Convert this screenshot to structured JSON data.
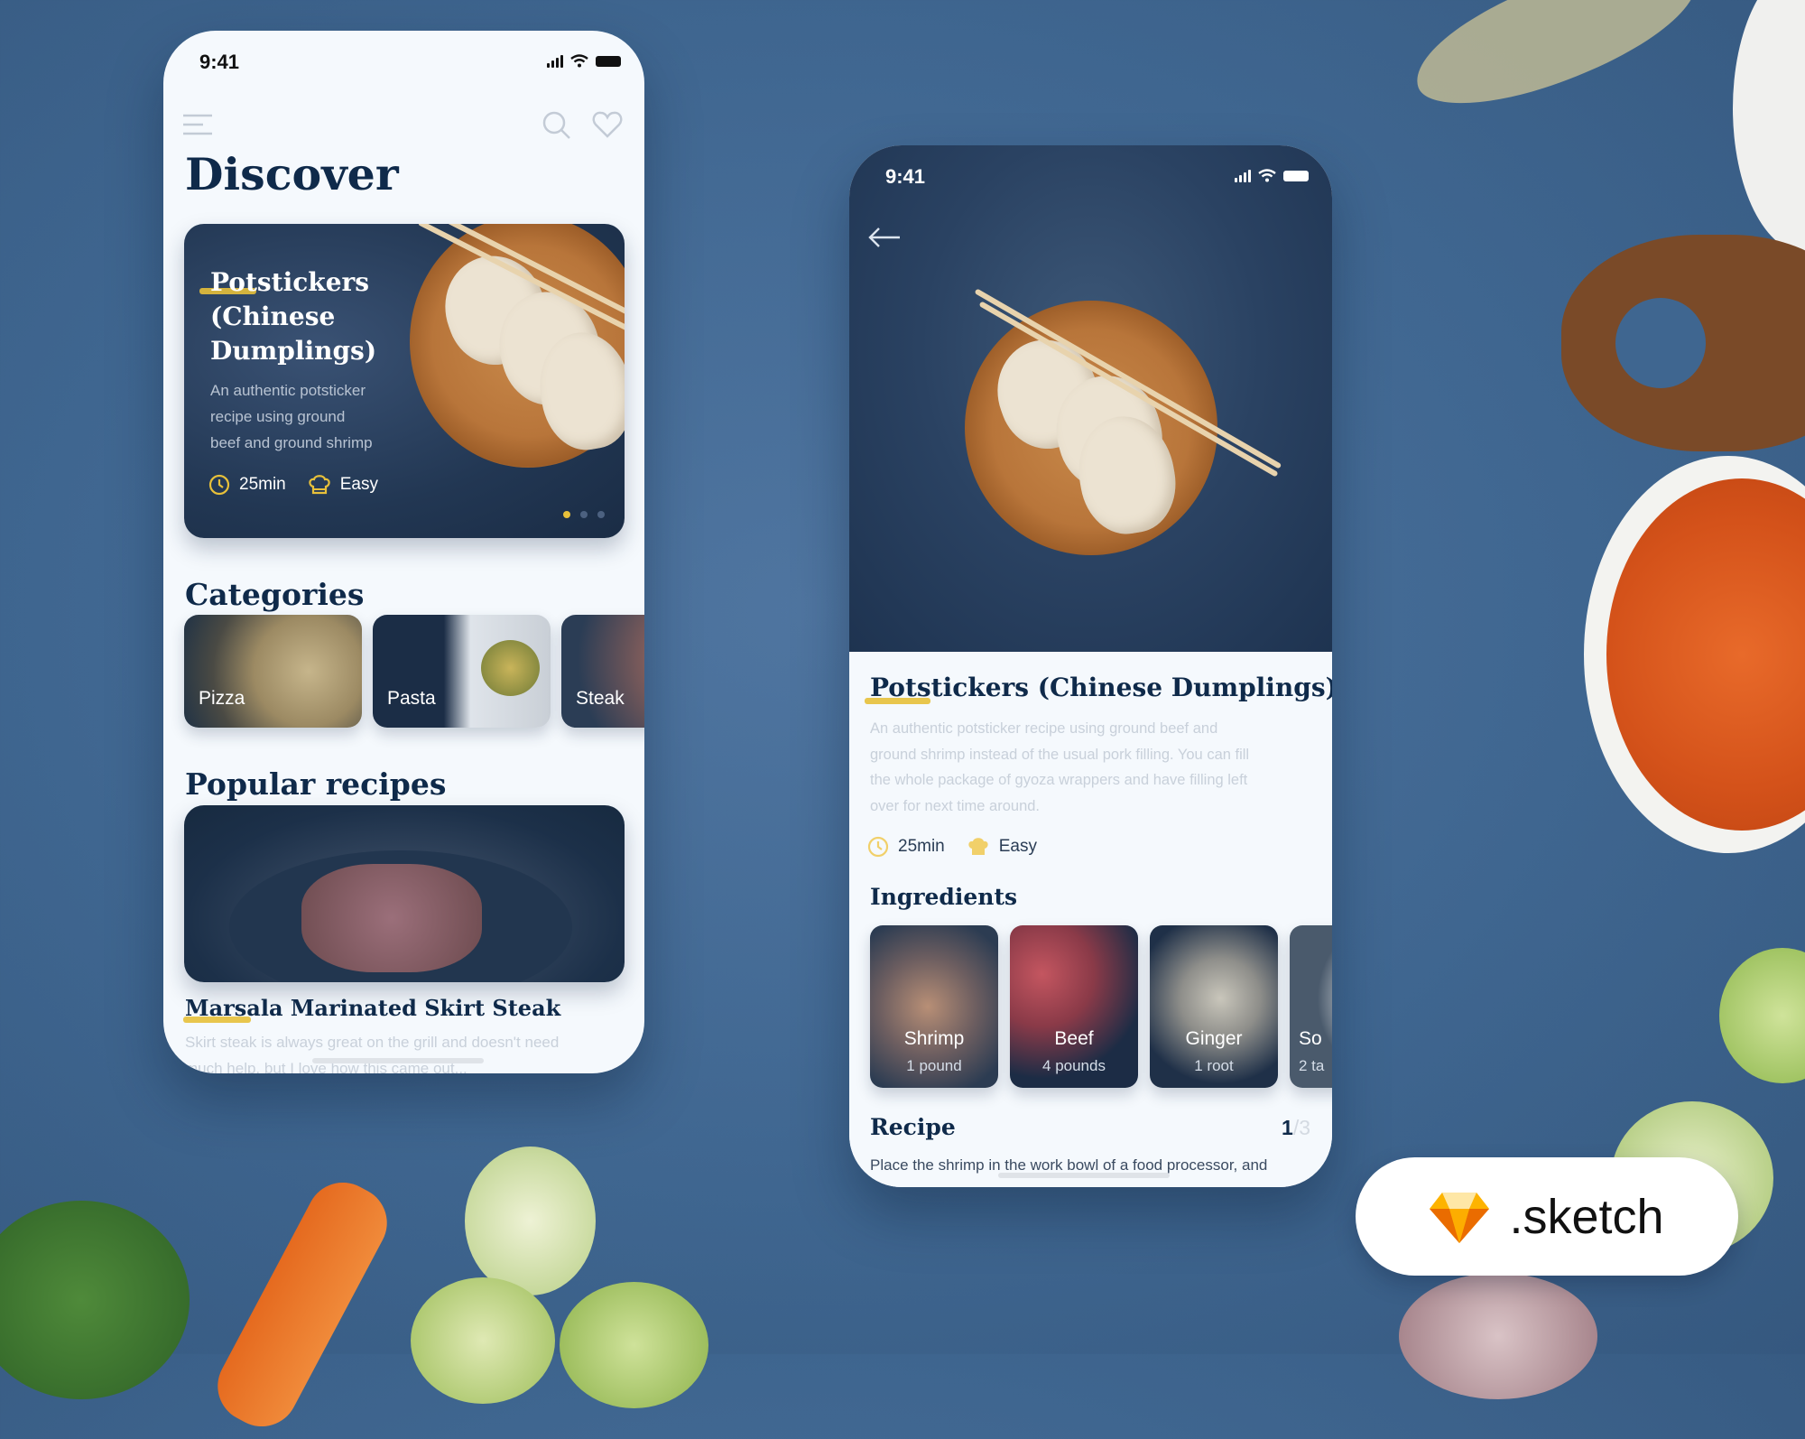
{
  "colors": {
    "background": "#4a6f99",
    "accent_yellow": "#e7c03a",
    "navy": "#0f2a4a",
    "screen_bg": "#f5f9fd"
  },
  "discover_screen": {
    "status_bar": {
      "time": "9:41"
    },
    "header": {
      "menu_icon": "hamburger-menu-icon",
      "search_icon": "search-icon",
      "favorites_icon": "heart-icon"
    },
    "title": "Discover",
    "featured": {
      "title_lines": [
        "Potstickers",
        "(Chinese",
        "Dumplings)"
      ],
      "description_lines": [
        "An authentic potsticker",
        "recipe using ground",
        "beef and ground shrimp"
      ],
      "time": "25min",
      "difficulty": "Easy",
      "carousel": {
        "current": 1,
        "total": 3
      }
    },
    "categories_heading": "Categories",
    "categories": [
      {
        "label": "Pizza"
      },
      {
        "label": "Pasta"
      },
      {
        "label": "Steak"
      }
    ],
    "popular_heading": "Popular recipes",
    "popular": [
      {
        "title": "Marsala Marinated Skirt Steak",
        "description_lines": [
          "Skirt steak is always great on the grill and doesn't need",
          "much help, but I love how this came out..."
        ]
      }
    ]
  },
  "detail_screen": {
    "status_bar": {
      "time": "9:41"
    },
    "back_icon": "arrow-left-icon",
    "title": "Potstickers (Chinese Dumplings)",
    "description_lines": [
      "An authentic potsticker recipe using ground beef and",
      "ground shrimp instead of the usual pork filling. You can fill",
      "the whole package of gyoza wrappers and have filling left",
      "over for next time around."
    ],
    "time": "25min",
    "difficulty": "Easy",
    "ingredients_heading": "Ingredients",
    "ingredients": [
      {
        "name": "Shrimp",
        "qty": "1 pound"
      },
      {
        "name": "Beef",
        "qty": "4 pounds"
      },
      {
        "name": "Ginger",
        "qty": "1 root"
      },
      {
        "name": "So",
        "qty": "2 ta"
      }
    ],
    "recipe_heading": "Recipe",
    "recipe_step": {
      "current": "1",
      "total": "/3"
    },
    "recipe_text": "Place the shrimp in the work bowl of a food processor, and"
  },
  "badge": {
    "label": ".sketch",
    "icon": "sketch-diamond-icon"
  }
}
